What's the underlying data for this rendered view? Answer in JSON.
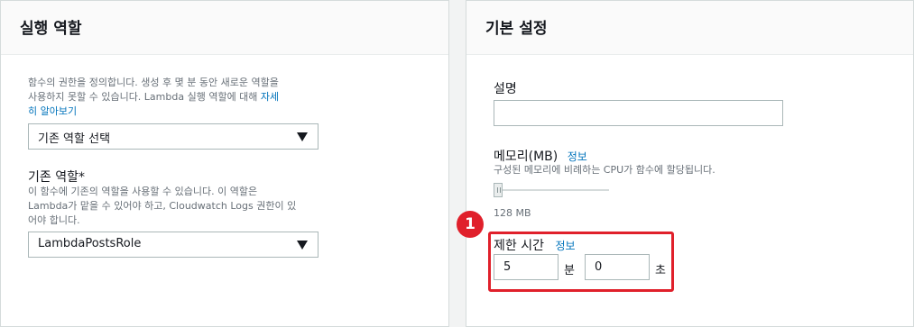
{
  "left_panel": {
    "title": "실행 역할",
    "description_line1": "함수의 권한을 정의합니다. 생성 후 몇 분 동안 새로운 역할을",
    "description_line2": "사용하지 못할 수 있습니다. Lambda 실행 역할에 대해 ",
    "learn_more_part1": "자세",
    "learn_more_part2": "히 알아보기",
    "role_select_value": "기존 역할 선택",
    "existing_role_label": "기존 역할*",
    "existing_role_help_line1": "이 함수에 기존의 역할을 사용할 수 있습니다. 이 역할은",
    "existing_role_help_line2": "Lambda가 맡을 수 있어야 하고, Cloudwatch Logs 권한이 있",
    "existing_role_help_line3": "어야 합니다.",
    "existing_role_value": "LambdaPostsRole"
  },
  "right_panel": {
    "title": "기본 설정",
    "description_label": "설명",
    "description_value": "",
    "memory_label": "메모리(MB)",
    "memory_info_link": "정보",
    "memory_help": "구성된 메모리에 비례하는 CPU가 함수에 할당됩니다.",
    "memory_value_text": "128 MB",
    "memory_slider_fraction": 0.0,
    "timeout_label": "제한 시간",
    "timeout_info_link": "정보",
    "timeout_minutes": "5",
    "minutes_unit": "분",
    "timeout_seconds": "0",
    "seconds_unit": "초"
  },
  "annotation": {
    "step_number": "1",
    "highlight_color": "#e0202b"
  }
}
